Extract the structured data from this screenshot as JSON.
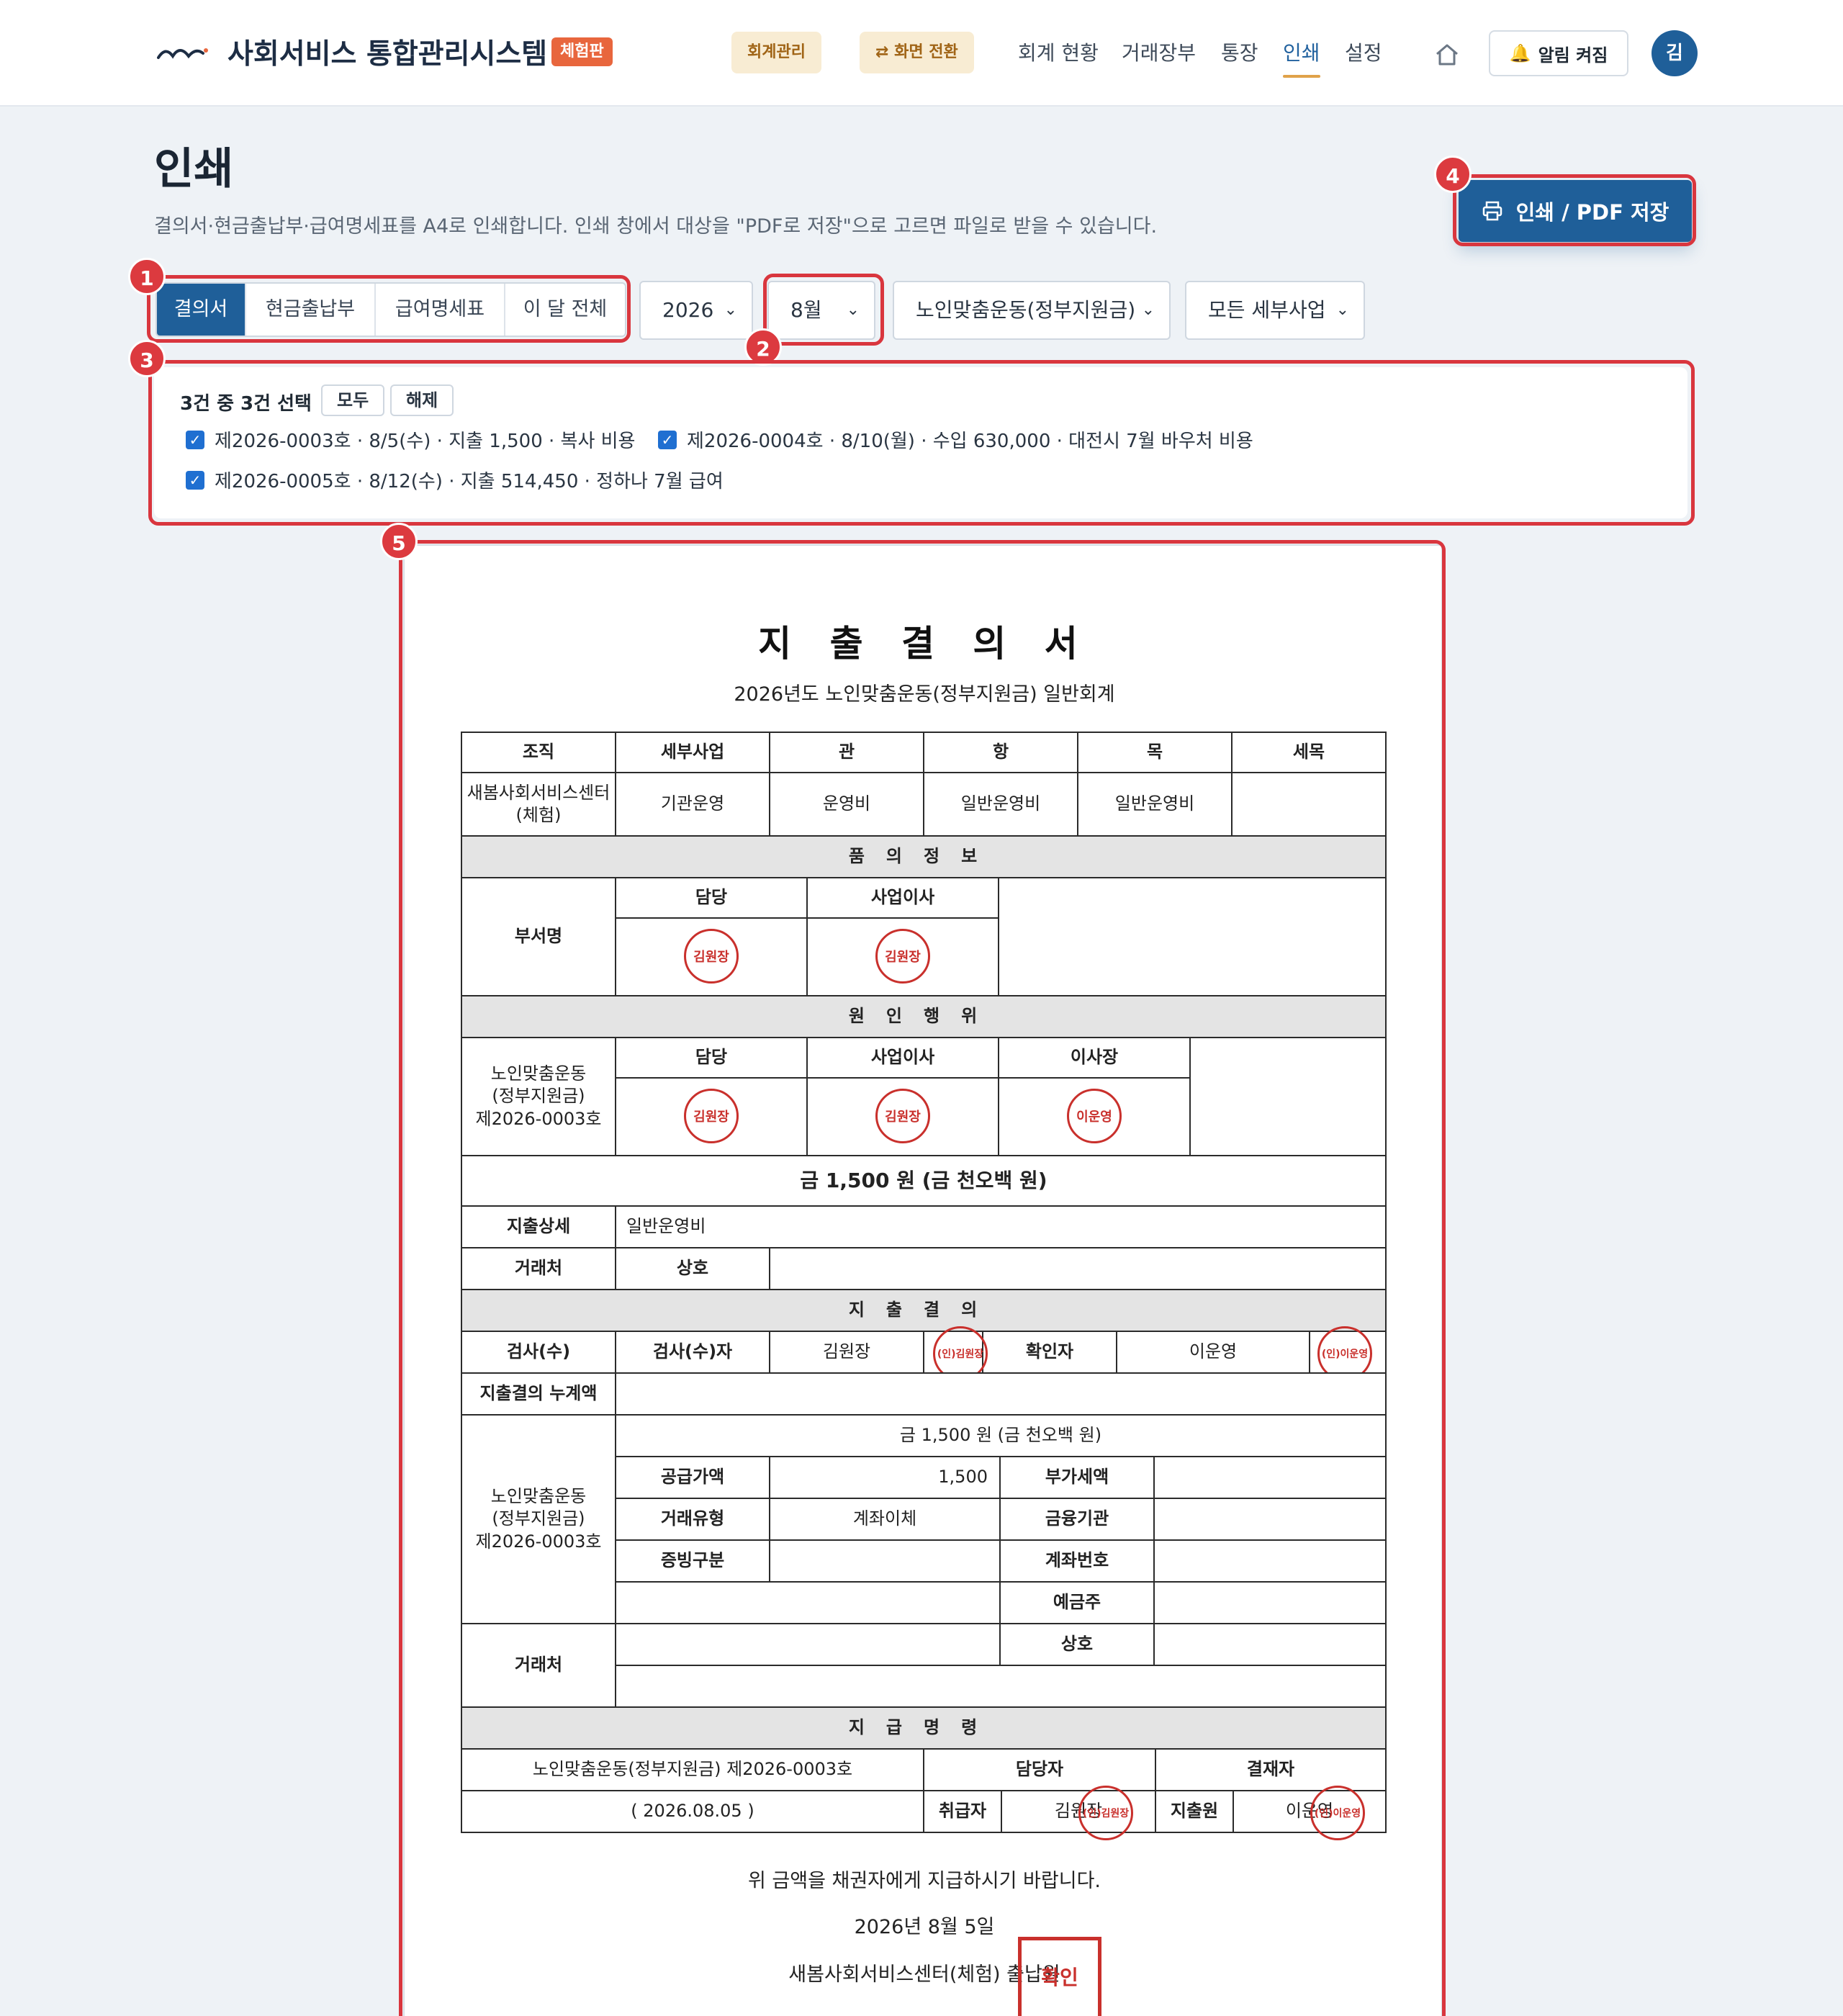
{
  "header": {
    "brand": "사회서비스 통합관리시스템",
    "badge": "체험판",
    "pill_accounting": "회계관리",
    "pill_switch": "⇄ 화면 전환",
    "nav": [
      "회계 현황",
      "거래장부",
      "통장",
      "인쇄",
      "설정"
    ],
    "active_nav": "인쇄",
    "alert_label": "알림 켜짐",
    "avatar": "김"
  },
  "page": {
    "title": "인쇄",
    "description": "결의서·현금출납부·급여명세표를 A4로 인쇄합니다. 인쇄 창에서 대상을 \"PDF로 저장\"으로 고르면 파일로 받을 수 있습니다.",
    "print_button": "인쇄 / PDF 저장"
  },
  "markers": [
    "1",
    "2",
    "3",
    "4",
    "5"
  ],
  "controls": {
    "tabs": [
      "결의서",
      "현금출납부",
      "급여명세표",
      "이 달 전체"
    ],
    "active_tab": "결의서",
    "year": "2026",
    "month": "8월",
    "program": "노인맞춤운동(정부지원금)",
    "subprogram": "모든 세부사업"
  },
  "selection": {
    "summary": "3건 중 3건 선택",
    "select_all": "모두",
    "clear": "해제",
    "items": [
      "제2026-0003호 · 8/5(수) · 지출 1,500 · 복사 비용",
      "제2026-0004호 · 8/10(월) · 수입 630,000 · 대전시 7월 바우처 비용",
      "제2026-0005호 · 8/12(수) · 지출 514,450 · 정하나 7월 급여"
    ]
  },
  "document": {
    "title": "지 출 결 의 서",
    "subtitle": "2026년도 노인맞춤운동(정부지원금) 일반회계",
    "budget_headers": [
      "조직",
      "세부사업",
      "관",
      "항",
      "목",
      "세목"
    ],
    "budget_values": [
      "새봄사회서비스센터(체험)",
      "기관운영",
      "운영비",
      "일반운영비",
      "일반운영비",
      ""
    ],
    "section_proposal": "품의정보",
    "dept_label": "부서명",
    "role_staff": "담당",
    "role_director": "사업이사",
    "role_chair": "이사장",
    "seal_kim": "김원장",
    "seal_lee": "이운영",
    "section_cause": "원인행위",
    "cause_label": "노인맞춤운동\n(정부지원금)\n제2026-0003호",
    "amount_line": "금 1,500 원 (금 천오백 원)",
    "detail_label": "지출상세",
    "detail_value": "일반운영비",
    "vendor_label": "거래처",
    "vendor_name_label": "상호",
    "section_resolution": "지출결의",
    "inspect_label": "검사(수)",
    "inspector_label": "검사(수)자",
    "inspector_name": "김원장",
    "seal_small_kim": "(인)김원장",
    "confirmer_label": "확인자",
    "confirmer_name": "이운영",
    "seal_small_lee": "(인)이운영",
    "cumulative_label": "지출결의 누계액",
    "amount_line_small": "금 1,500 원 (금 천오백 원)",
    "supply_label": "공급가액",
    "supply_value": "1,500",
    "vat_label": "부가세액",
    "tx_type_label": "거래유형",
    "tx_type_value": "계좌이체",
    "bank_label": "금융기관",
    "evidence_label": "증빙구분",
    "account_label": "계좌번호",
    "holder_label": "예금주",
    "vendor_name_label2": "상호",
    "section_payment": "지급명령",
    "payment_ref": "노인맞춤운동(정부지원금) 제2026-0003호",
    "manager_label": "담당자",
    "approver_label": "결재자",
    "payment_date": "( 2026.08.05 )",
    "handler_label": "취급자",
    "handler_name": "김원장",
    "payer_label": "지출원",
    "payer_name": "이운영",
    "closing_line": "위 금액을 채권자에게 지급하시기 바랍니다.",
    "closing_date": "2026년 8월 5일",
    "closing_org": "새봄사회서비스센터(체험) 출납원",
    "approve_stamp": "확인"
  },
  "colors": {
    "primary": "#1f5f99",
    "highlight": "#d9363e",
    "seal": "#c9302c",
    "badge": "#e8663d"
  }
}
